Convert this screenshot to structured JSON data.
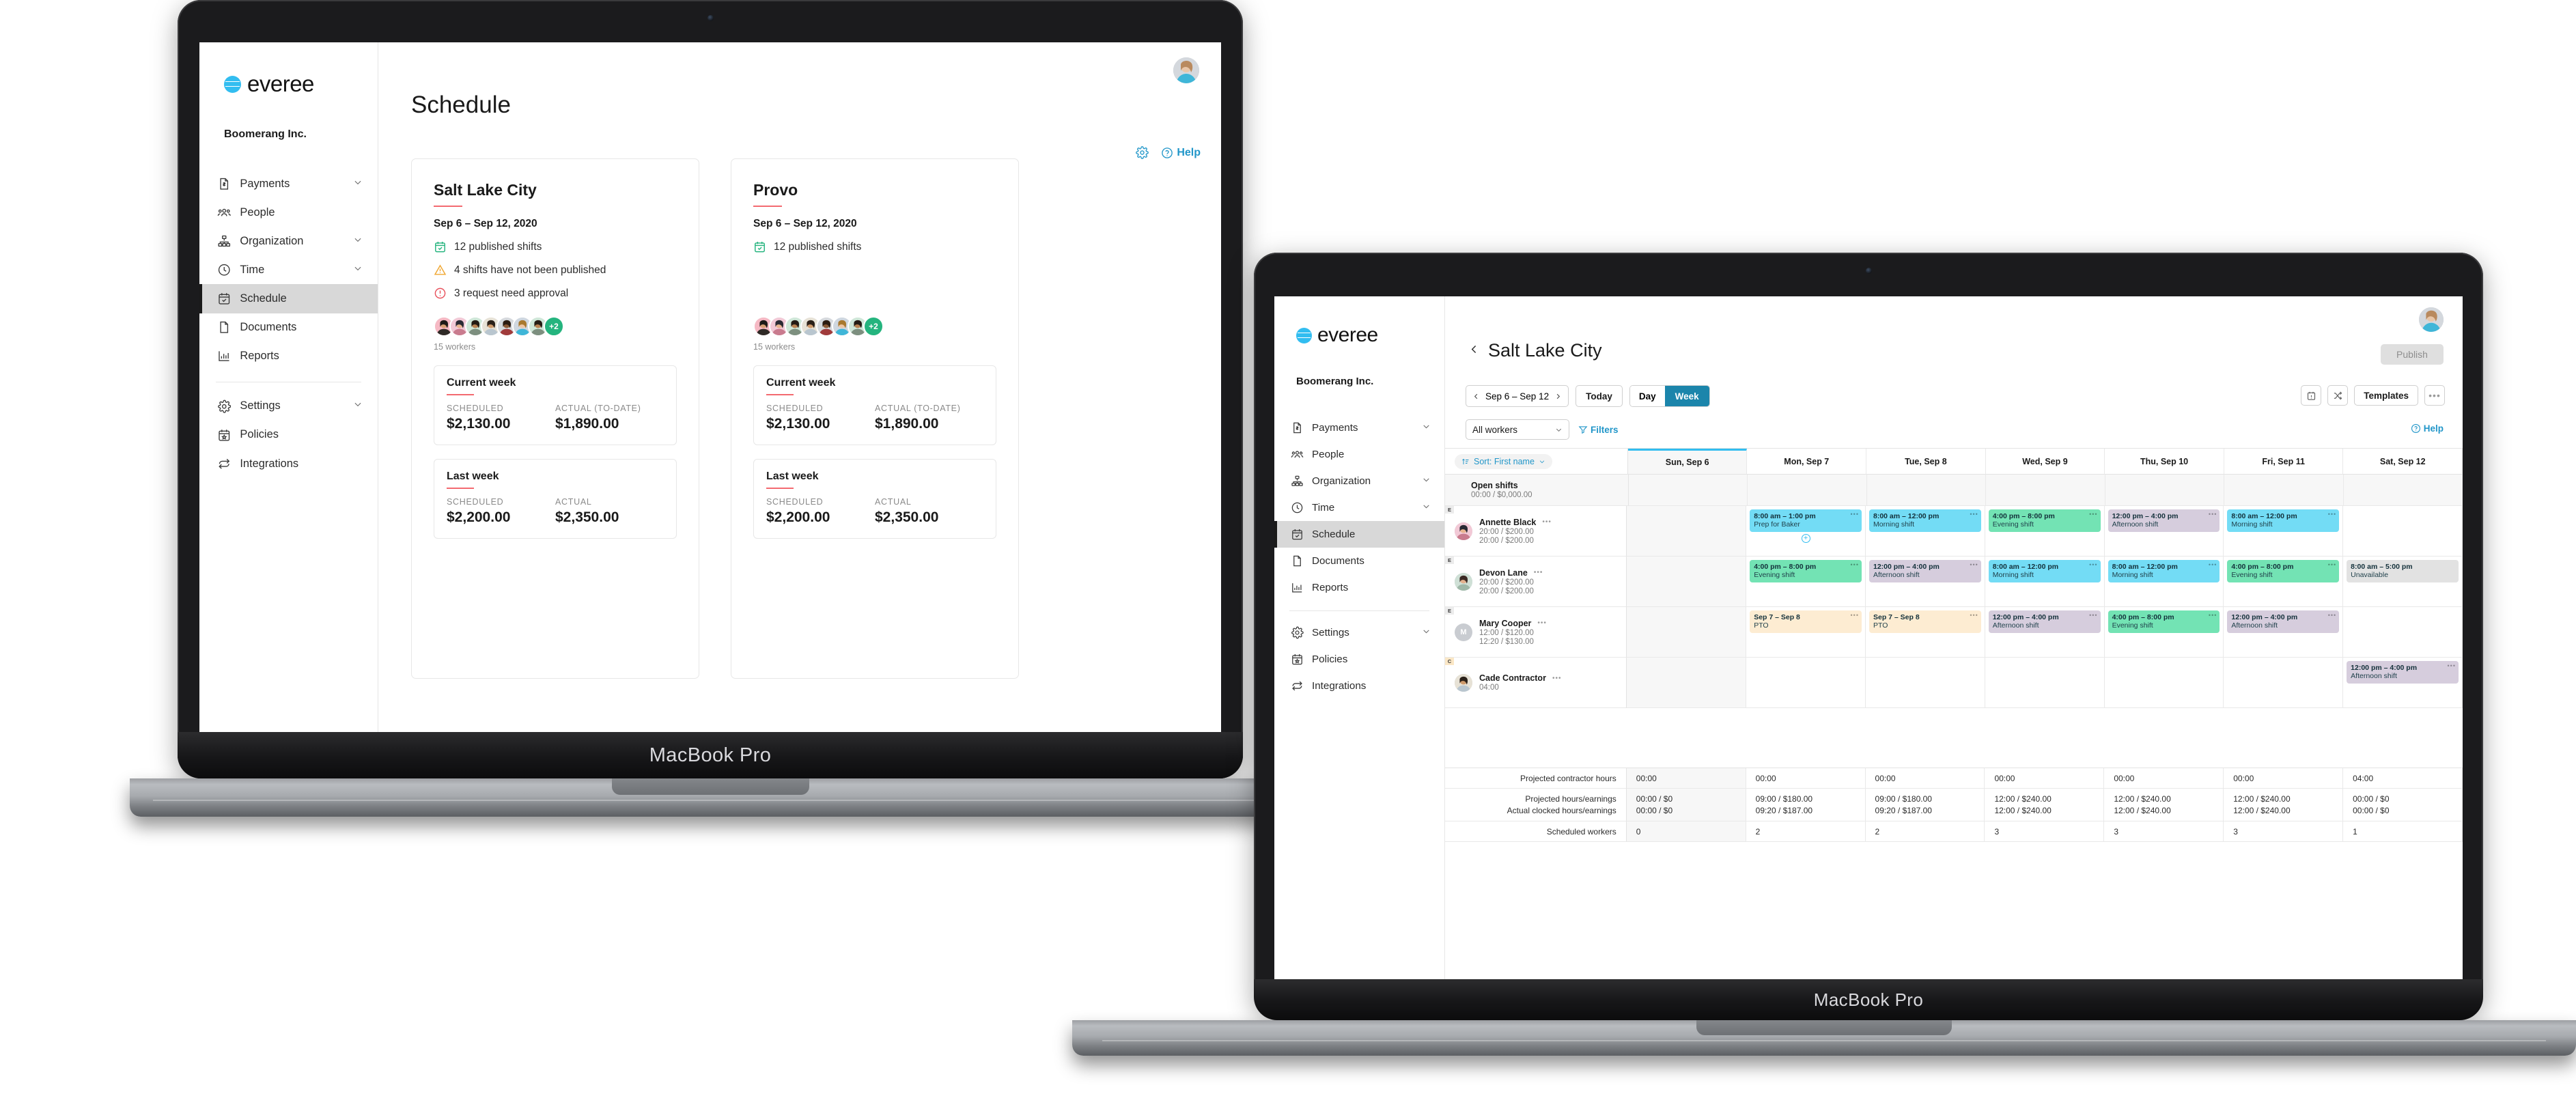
{
  "brand": {
    "name": "everee",
    "org": "Boomerang Inc."
  },
  "device_label": "MacBook Pro",
  "sidebar": {
    "items": [
      {
        "label": "Payments",
        "icon": "document-dollar-icon",
        "chevron": true
      },
      {
        "label": "People",
        "icon": "people-icon",
        "chevron": false
      },
      {
        "label": "Organization",
        "icon": "org-chart-icon",
        "chevron": true
      },
      {
        "label": "Time",
        "icon": "clock-icon",
        "chevron": true
      },
      {
        "label": "Schedule",
        "icon": "calendar-check-icon",
        "chevron": false,
        "active": true
      },
      {
        "label": "Documents",
        "icon": "page-icon",
        "chevron": false
      },
      {
        "label": "Reports",
        "icon": "bar-chart-icon",
        "chevron": false
      }
    ],
    "footer_items": [
      {
        "label": "Settings",
        "icon": "gear-icon",
        "chevron": true
      },
      {
        "label": "Policies",
        "icon": "policy-icon",
        "chevron": false
      },
      {
        "label": "Integrations",
        "icon": "sync-icon",
        "chevron": false
      }
    ]
  },
  "laptop1": {
    "page_title": "Schedule",
    "help_label": "Help",
    "cards": [
      {
        "name": "Salt Lake City",
        "range": "Sep 6 – Sep 12, 2020",
        "stats": [
          {
            "icon": "calendar-check-icon",
            "text": "12 published shifts",
            "tone": "#24b47e"
          },
          {
            "icon": "warning-triangle-icon",
            "text": "4 shifts have not been published",
            "tone": "#f0a732"
          },
          {
            "icon": "alert-circle-icon",
            "text": "3 request need approval",
            "tone": "#e8505b"
          }
        ],
        "avatar_overflow": "+2",
        "workers": "15 workers",
        "weeks": [
          {
            "title": "Current week",
            "left_label": "SCHEDULED",
            "left_value": "$2,130.00",
            "right_label": "ACTUAL (TO-DATE)",
            "right_value": "$1,890.00"
          },
          {
            "title": "Last week",
            "left_label": "SCHEDULED",
            "left_value": "$2,200.00",
            "right_label": "ACTUAL",
            "right_value": "$2,350.00"
          }
        ]
      },
      {
        "name": "Provo",
        "range": "Sep 6 – Sep 12, 2020",
        "stats": [
          {
            "icon": "calendar-check-icon",
            "text": "12 published shifts",
            "tone": "#24b47e"
          }
        ],
        "avatar_overflow": "+2",
        "workers": "15 workers",
        "weeks": [
          {
            "title": "Current week",
            "left_label": "SCHEDULED",
            "left_value": "$2,130.00",
            "right_label": "ACTUAL (TO-DATE)",
            "right_value": "$1,890.00"
          },
          {
            "title": "Last week",
            "left_label": "SCHEDULED",
            "left_value": "$2,200.00",
            "right_label": "ACTUAL",
            "right_value": "$2,350.00"
          }
        ]
      }
    ]
  },
  "laptop2": {
    "title": "Salt Lake City",
    "publish_label": "Publish",
    "date_range": "Sep 6 – Sep 12",
    "today_label": "Today",
    "day_label": "Day",
    "week_label": "Week",
    "active_view": "Week",
    "worker_filter": "All workers",
    "filters_label": "Filters",
    "help_label": "Help",
    "templates_label": "Templates",
    "more_label": "…",
    "sort_label": "Sort: First name",
    "columns": [
      "Sun, Sep 6",
      "Mon, Sep 7",
      "Tue, Sep 8",
      "Wed, Sep 9",
      "Thu, Sep 10",
      "Fri, Sep 11",
      "Sat, Sep 12"
    ],
    "rows": [
      {
        "tag": "",
        "name": "Open shifts",
        "sub1": "00:00 / $0,000.00",
        "sub2": "",
        "avatar_kind": "none",
        "cells": [
          [],
          [],
          [],
          [],
          [],
          [],
          []
        ]
      },
      {
        "tag": "E",
        "name": "Annette Black",
        "sub1": "20:00 / $200.00",
        "sub2": "20:00 / $200.00",
        "avatar_kind": "photo-f1",
        "cells": [
          [],
          [
            {
              "time": "8:00 am – 1:00 pm",
              "label": "Prep for Baker",
              "color": "blue",
              "add": true
            }
          ],
          [
            {
              "time": "8:00 am – 12:00 pm",
              "label": "Morning shift",
              "color": "blue"
            }
          ],
          [
            {
              "time": "4:00 pm – 8:00 pm",
              "label": "Evening shift",
              "color": "green"
            }
          ],
          [
            {
              "time": "12:00 pm – 4:00 pm",
              "label": "Afternoon shift",
              "color": "purple"
            }
          ],
          [
            {
              "time": "8:00 am – 12:00 pm",
              "label": "Morning shift",
              "color": "blue"
            }
          ],
          []
        ]
      },
      {
        "tag": "E",
        "name": "Devon Lane",
        "sub1": "20:00 / $200.00",
        "sub2": "20:00 / $200.00",
        "avatar_kind": "photo-f2",
        "cells": [
          [],
          [
            {
              "time": "4:00 pm – 8:00 pm",
              "label": "Evening shift",
              "color": "green"
            }
          ],
          [
            {
              "time": "12:00 pm – 4:00 pm",
              "label": "Afternoon shift",
              "color": "purple"
            }
          ],
          [
            {
              "time": "8:00 am – 12:00 pm",
              "label": "Morning shift",
              "color": "blue"
            }
          ],
          [
            {
              "time": "8:00 am – 12:00 pm",
              "label": "Morning shift",
              "color": "blue"
            }
          ],
          [
            {
              "time": "4:00 pm – 8:00 pm",
              "label": "Evening shift",
              "color": "green"
            }
          ],
          [
            {
              "time": "8:00 am – 5:00 pm",
              "label": "Unavailable",
              "color": "grey"
            }
          ]
        ]
      },
      {
        "tag": "E",
        "name": "Mary Cooper",
        "sub1": "12:00 / $120.00",
        "sub2": "12:20 / $130.00",
        "avatar_kind": "initial",
        "avatar_initial": "M",
        "cells": [
          [],
          [
            {
              "time": "Sep 7 – Sep 8",
              "label": "PTO",
              "color": "cream"
            }
          ],
          [
            {
              "time": "Sep 7 – Sep 8",
              "label": "PTO",
              "color": "cream"
            }
          ],
          [
            {
              "time": "12:00 pm – 4:00 pm",
              "label": "Afternoon shift",
              "color": "purple"
            }
          ],
          [
            {
              "time": "4:00 pm – 8:00 pm",
              "label": "Evening shift",
              "color": "green"
            }
          ],
          [
            {
              "time": "12:00 pm – 4:00 pm",
              "label": "Afternoon shift",
              "color": "purple"
            }
          ],
          []
        ]
      },
      {
        "tag": "C",
        "name": "Cade Contractor",
        "sub1": "04:00",
        "sub2": "",
        "avatar_kind": "photo-m1",
        "cells": [
          [],
          [],
          [],
          [],
          [],
          [],
          [
            {
              "time": "12:00 pm – 4:00 pm",
              "label": "Afternoon shift",
              "color": "purple"
            }
          ]
        ]
      }
    ],
    "footer": [
      {
        "label": "Projected contractor hours",
        "values": [
          "00:00",
          "00:00",
          "00:00",
          "00:00",
          "00:00",
          "00:00",
          "04:00"
        ]
      },
      {
        "label": "Projected hours/earnings",
        "label2": "Actual clocked hours/earnings",
        "values": [
          "00:00 / $0",
          "09:00 / $180.00",
          "09:00 / $180.00",
          "12:00 / $240.00",
          "12:00 / $240.00",
          "12:00 / $240.00",
          "00:00 / $0"
        ],
        "values2": [
          "00:00 / $0",
          "09:20 / $187.00",
          "09:20 / $187.00",
          "12:00 / $240.00",
          "12:00 / $240.00",
          "12:00 / $240.00",
          "00:00 / $0"
        ]
      },
      {
        "label": "Scheduled workers",
        "values": [
          "0",
          "2",
          "2",
          "3",
          "3",
          "3",
          "1"
        ]
      }
    ]
  },
  "colors": {
    "accent_blue": "#2196c9",
    "brand_cyan": "#32bdf0",
    "red_rule": "#f36a70",
    "green": "#24b47e",
    "seg_active": "#1b85ab"
  }
}
